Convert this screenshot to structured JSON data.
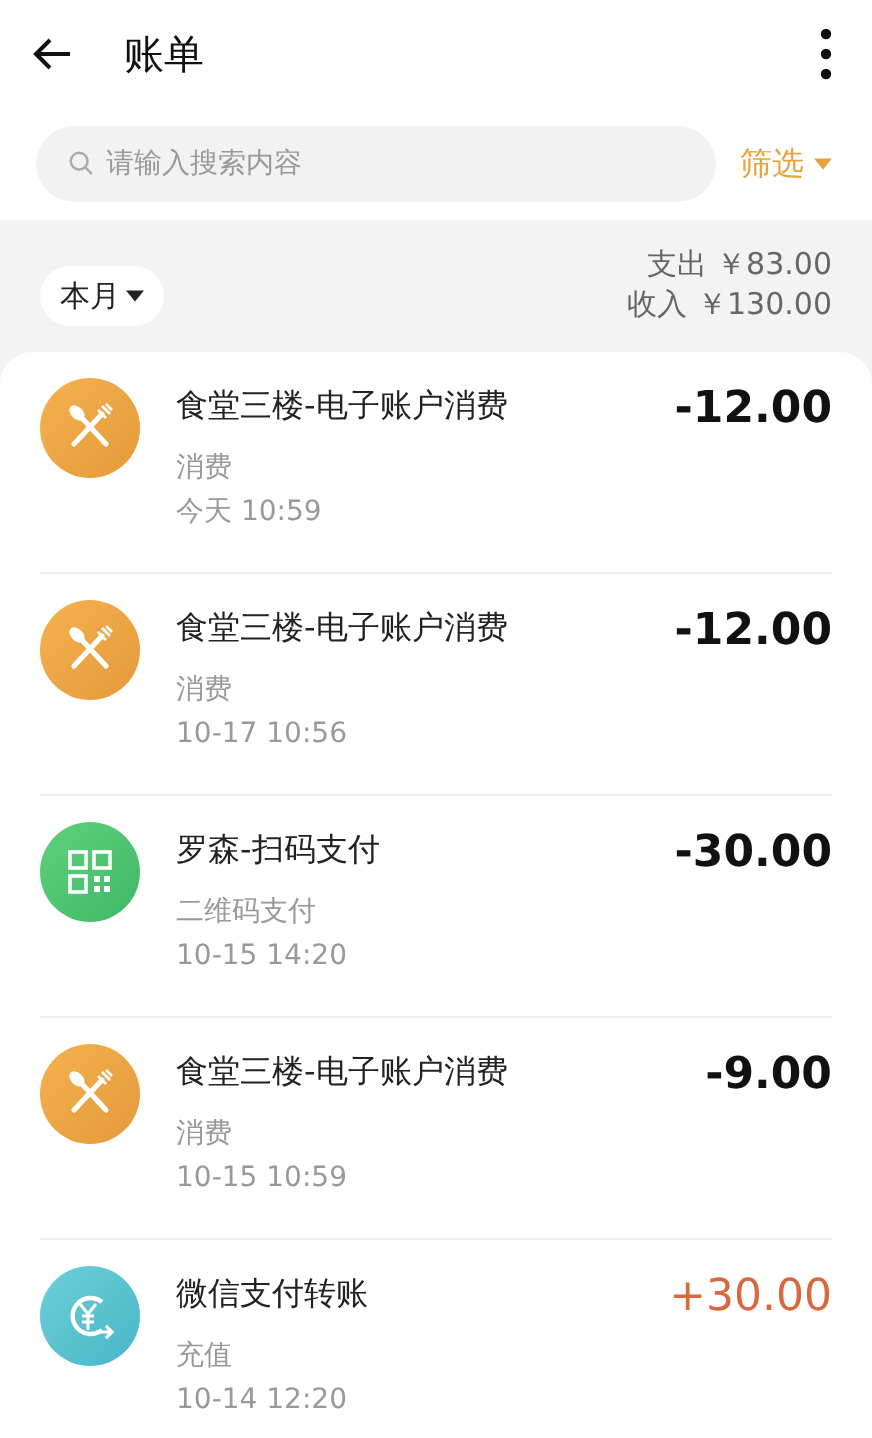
{
  "header": {
    "title": "账单"
  },
  "search": {
    "placeholder": "请输入搜索内容"
  },
  "filter": {
    "label": "筛选"
  },
  "period": {
    "label": "本月"
  },
  "summary": {
    "expense": "支出 ￥83.00",
    "income": "收入 ￥130.00"
  },
  "transactions": [
    {
      "kind": "dining",
      "title": "食堂三楼-电子账户消费",
      "category": "消费",
      "time": "今天 10:59",
      "amount": "-12.00",
      "income": false
    },
    {
      "kind": "dining",
      "title": "食堂三楼-电子账户消费",
      "category": "消费",
      "time": "10-17 10:56",
      "amount": "-12.00",
      "income": false
    },
    {
      "kind": "qrcode",
      "title": "罗森-扫码支付",
      "category": "二维码支付",
      "time": "10-15 14:20",
      "amount": "-30.00",
      "income": false
    },
    {
      "kind": "dining",
      "title": "食堂三楼-电子账户消费",
      "category": "消费",
      "time": "10-15 10:59",
      "amount": "-9.00",
      "income": false
    },
    {
      "kind": "transfer",
      "title": "微信支付转账",
      "category": "充值",
      "time": "10-14 12:20",
      "amount": "+30.00",
      "income": true
    }
  ]
}
